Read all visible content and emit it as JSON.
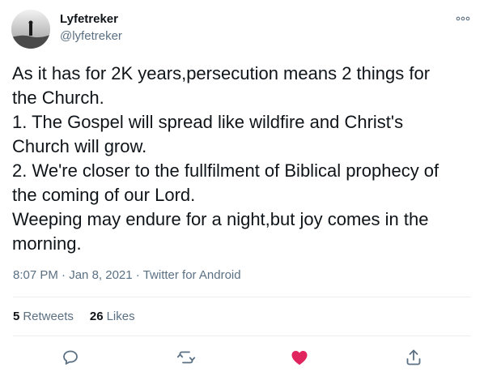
{
  "user": {
    "name": "Lyfetreker",
    "handle": "@lyfetreker"
  },
  "tweet": {
    "lines": [
      "As it has for 2K years,persecution means 2 things for",
      "the Church.",
      "1. The Gospel will spread like wildfire and Christ's",
      "Church will grow.",
      "2. We're closer to the fullfilment of Biblical prophecy of",
      "the coming of our Lord.",
      "Weeping may endure for a night,but joy comes in the",
      "morning."
    ],
    "time": "8:07 PM",
    "date": "Jan 8, 2021",
    "source": "Twitter for Android"
  },
  "stats": {
    "retweets_count": "5",
    "retweets_label": "Retweets",
    "likes_count": "26",
    "likes_label": "Likes"
  },
  "actions": {
    "reply_icon": "reply-icon",
    "retweet_icon": "retweet-icon",
    "like_icon": "heart-icon",
    "share_icon": "share-icon",
    "liked": true,
    "like_color": "#e0245e",
    "icon_color": "#5b7083"
  }
}
